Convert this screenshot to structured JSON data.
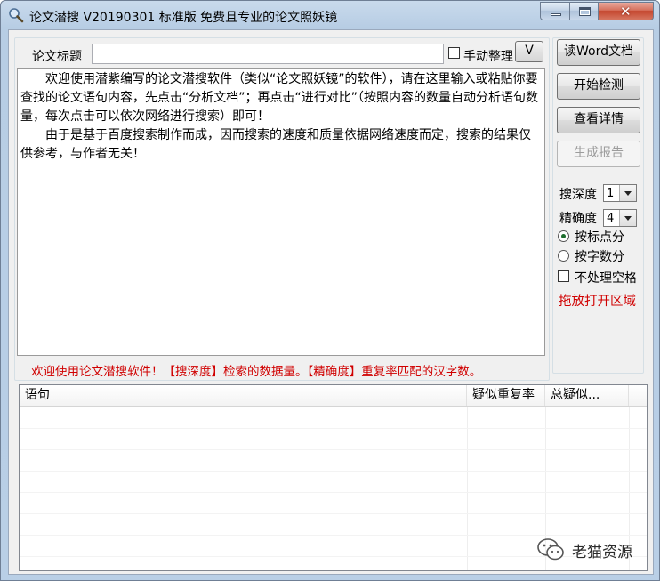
{
  "window": {
    "title": "论文潜搜 V20190301 标准版 免费且专业的论文照妖镜"
  },
  "form": {
    "title_label": "论文标题",
    "title_value": "",
    "manual_label": "手动整理",
    "v_button_label": "V"
  },
  "editor": {
    "paragraph1": "欢迎使用潜紫编写的论文潜搜软件（类似“论文照妖镜”的软件），请在这里输入或粘贴你要查找的论文语句内容，先点击“分析文档”；再点击“进行对比”（按照内容的数量自动分析语句数量，每次点击可以依次网络进行搜索）即可！",
    "paragraph2": "由于是基于百度搜索制作而成，因而搜索的速度和质量依据网络速度而定，搜索的结果仅供参考，与作者无关！"
  },
  "status": "欢迎使用论文潜搜软件！【搜深度】检索的数据量。【精确度】重复率匹配的汉字数。",
  "buttons": {
    "read_word": "读Word文档",
    "start_check": "开始检测",
    "view_details": "查看详情",
    "generate_report": "生成报告"
  },
  "options": {
    "depth_label": "搜深度",
    "depth_value": "1",
    "precision_label": "精确度",
    "precision_value": "4",
    "radio_punct": "按标点分",
    "radio_words": "按字数分",
    "radio_selected": "按标点分",
    "no_space_label": "不处理空格",
    "no_space_checked": false,
    "drop_label": "拖放打开区域"
  },
  "results_table": {
    "columns": [
      "语句",
      "疑似重复率",
      "总疑似..."
    ],
    "rows": []
  },
  "watermark": {
    "text": "老猫资源",
    "icon": "wechat-icon"
  },
  "colors": {
    "status_red": "#d00000",
    "titlebar": "#b9cfe6",
    "close_red": "#c4462e"
  }
}
